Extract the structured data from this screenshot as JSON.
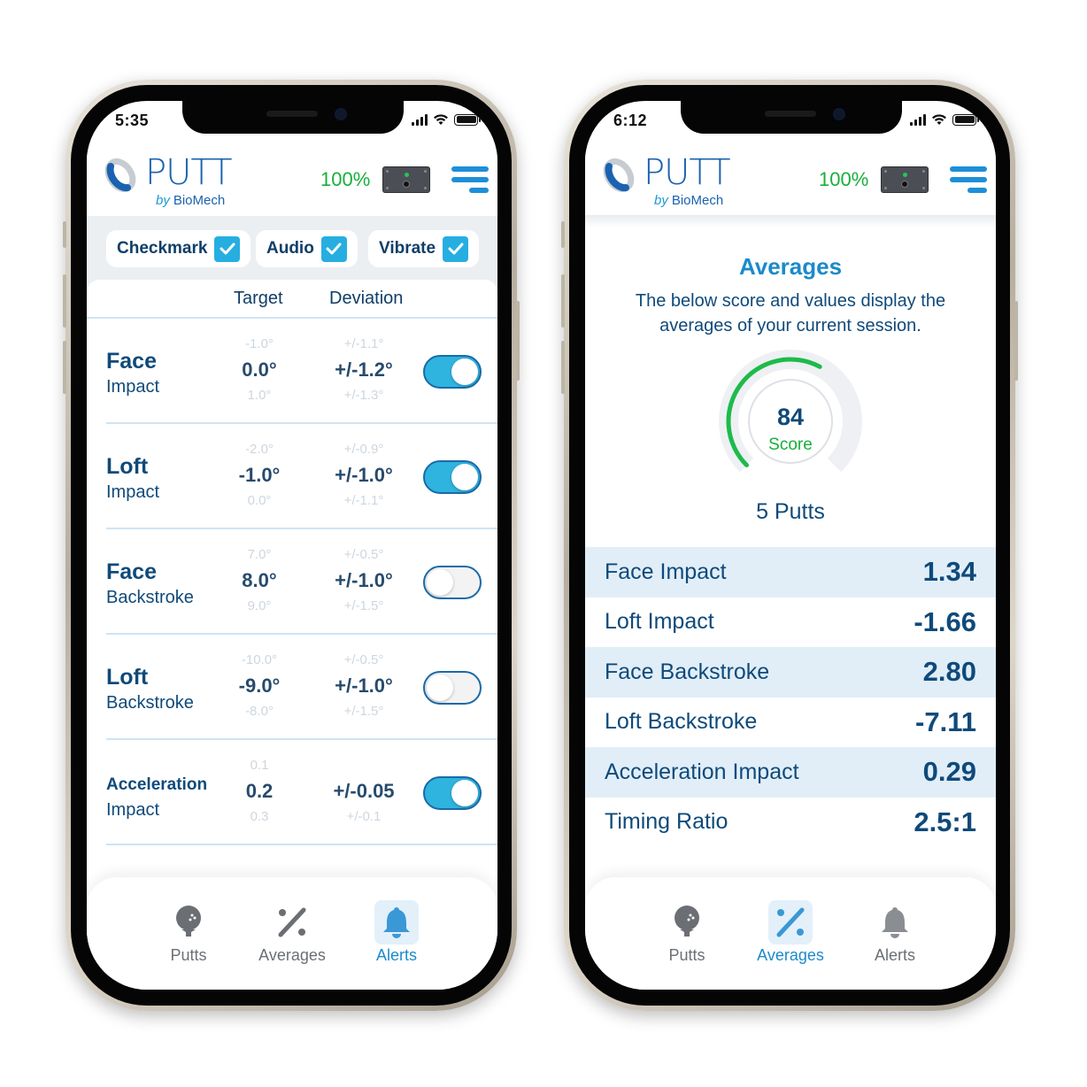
{
  "colors": {
    "brand_blue": "#1a62b0",
    "accent_cyan": "#26aee0",
    "text_navy": "#0f4a7a",
    "success_green": "#17b03a",
    "row_shade": "#e1eef8",
    "tab_inactive": "#6b6f74"
  },
  "left_phone": {
    "status_bar": {
      "time": "5:35",
      "icons": [
        "cellular-signal-icon",
        "wifi-icon",
        "battery-icon"
      ]
    },
    "header": {
      "logo_word": "PUTT",
      "logo_by": "by",
      "logo_brand": "BioMech",
      "battery_percent": "100%",
      "device_icon": "sensor-device-icon",
      "menu_icon": "hamburger-menu-icon"
    },
    "alert_options": [
      {
        "label": "Checkmark",
        "checked": true
      },
      {
        "label": "Audio",
        "checked": true
      },
      {
        "label": "Vibrate",
        "checked": true
      }
    ],
    "columns": {
      "target": "Target",
      "deviation": "Deviation"
    },
    "settings": [
      {
        "name": "Face",
        "sub": "Impact",
        "target_prev": "-1.0°",
        "target": "0.0°",
        "target_next": "1.0°",
        "dev_prev": "+/-1.1°",
        "dev": "+/-1.2°",
        "dev_next": "+/-1.3°",
        "enabled": true
      },
      {
        "name": "Loft",
        "sub": "Impact",
        "target_prev": "-2.0°",
        "target": "-1.0°",
        "target_next": "0.0°",
        "dev_prev": "+/-0.9°",
        "dev": "+/-1.0°",
        "dev_next": "+/-1.1°",
        "enabled": true
      },
      {
        "name": "Face",
        "sub": "Backstroke",
        "target_prev": "7.0°",
        "target": "8.0°",
        "target_next": "9.0°",
        "dev_prev": "+/-0.5°",
        "dev": "+/-1.0°",
        "dev_next": "+/-1.5°",
        "enabled": false
      },
      {
        "name": "Loft",
        "sub": "Backstroke",
        "target_prev": "-10.0°",
        "target": "-9.0°",
        "target_next": "-8.0°",
        "dev_prev": "+/-0.5°",
        "dev": "+/-1.0°",
        "dev_next": "+/-1.5°",
        "enabled": false
      },
      {
        "name": "Acceleration",
        "sub": "Impact",
        "target_prev": "0.1",
        "target": "0.2",
        "target_next": "0.3",
        "dev_prev": "",
        "dev": "+/-0.05",
        "dev_next": "+/-0.1",
        "enabled": true
      }
    ],
    "tabs": [
      {
        "label": "Putts",
        "icon": "golf-ball-tee-icon",
        "active": false
      },
      {
        "label": "Averages",
        "icon": "percent-icon",
        "active": false
      },
      {
        "label": "Alerts",
        "icon": "bell-icon",
        "active": true
      }
    ]
  },
  "right_phone": {
    "status_bar": {
      "time": "6:12",
      "icons": [
        "cellular-signal-icon",
        "wifi-icon",
        "battery-icon"
      ]
    },
    "header": {
      "logo_word": "PUTT",
      "logo_by": "by",
      "logo_brand": "BioMech",
      "battery_percent": "100%",
      "device_icon": "sensor-device-icon",
      "menu_icon": "hamburger-menu-icon"
    },
    "title": "Averages",
    "description": "The below score and values display the averages of your current session.",
    "score": {
      "value": "84",
      "label": "Score",
      "fraction": 0.84
    },
    "putts": "5 Putts",
    "averages": [
      {
        "label": "Face Impact",
        "value": "1.34"
      },
      {
        "label": "Loft Impact",
        "value": "-1.66"
      },
      {
        "label": "Face Backstroke",
        "value": "2.80"
      },
      {
        "label": "Loft Backstroke",
        "value": "-7.11"
      },
      {
        "label": "Acceleration Impact",
        "value": "0.29"
      },
      {
        "label": "Timing Ratio",
        "value": "2.5:1"
      }
    ],
    "tabs": [
      {
        "label": "Putts",
        "icon": "golf-ball-tee-icon",
        "active": false
      },
      {
        "label": "Averages",
        "icon": "percent-icon",
        "active": true
      },
      {
        "label": "Alerts",
        "icon": "bell-icon",
        "active": false
      }
    ]
  }
}
